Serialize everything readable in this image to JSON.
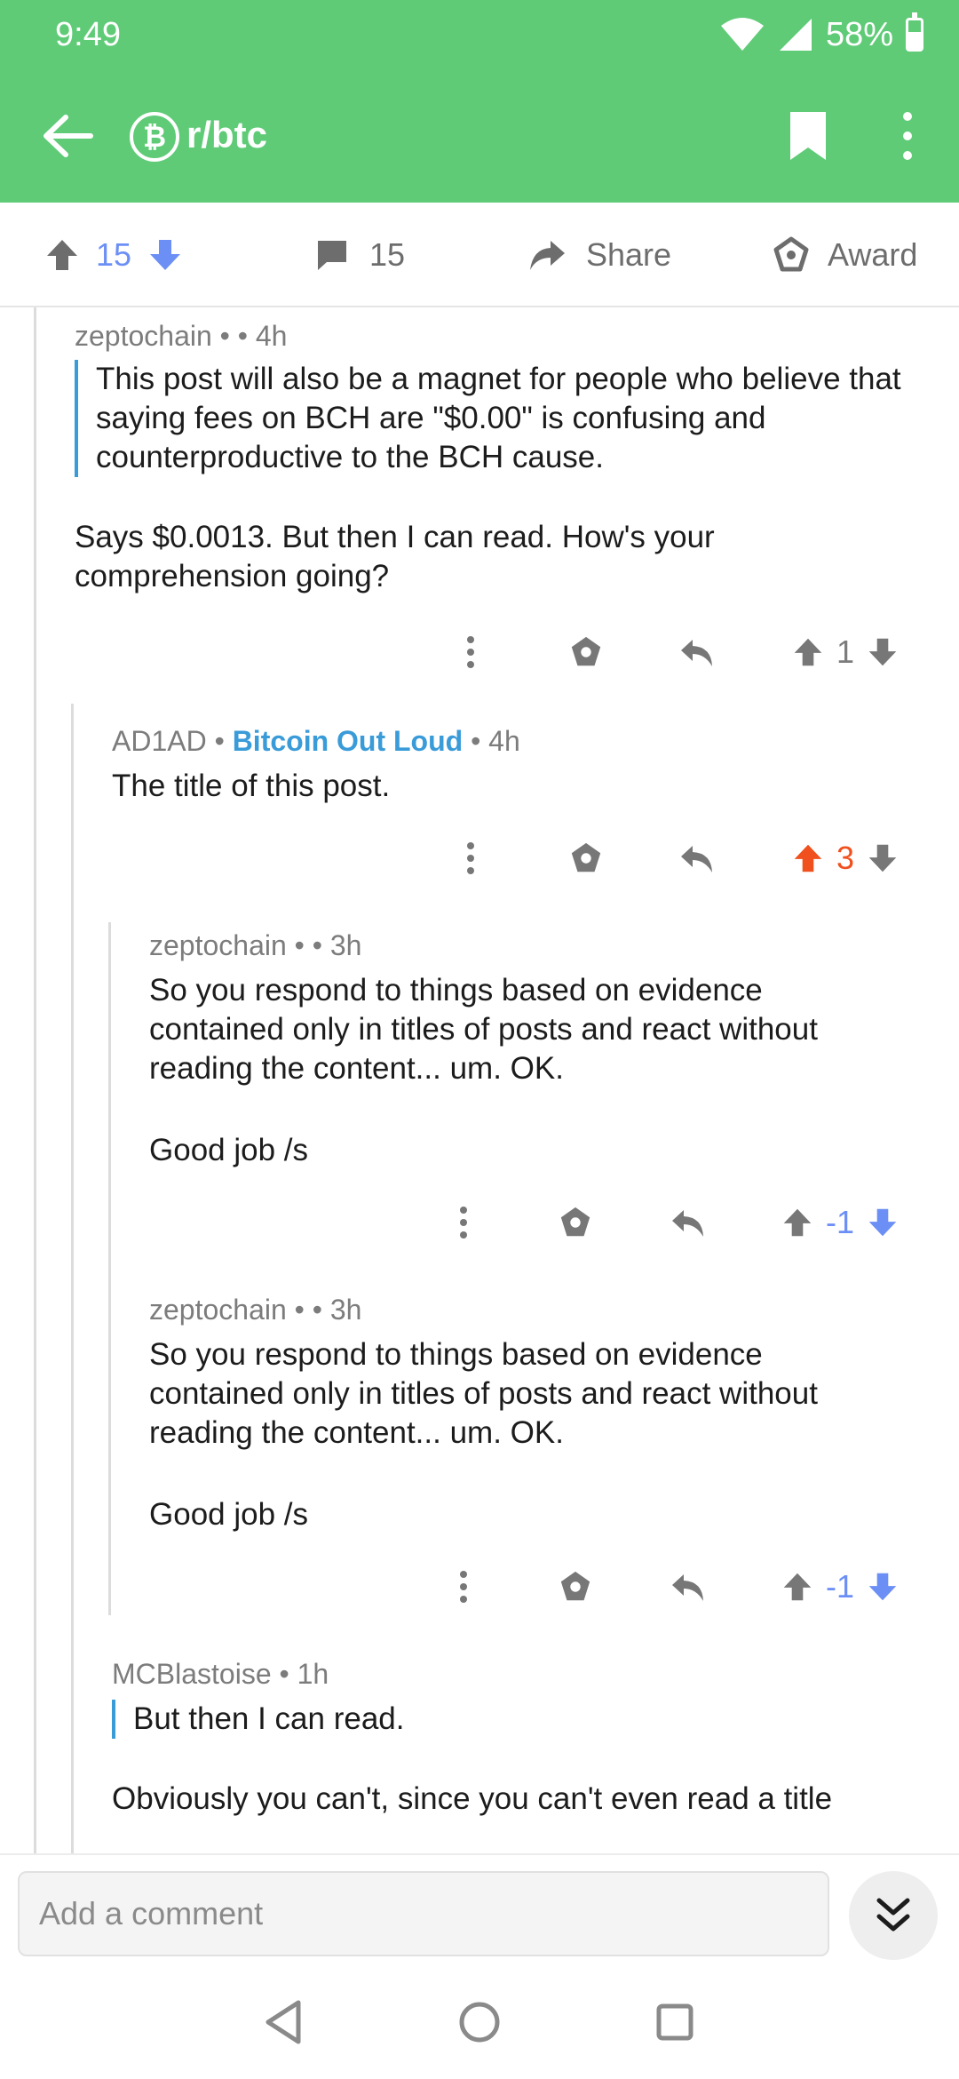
{
  "status_bar": {
    "time": "9:49",
    "battery": "58%",
    "battery_level": 0.58
  },
  "app_bar": {
    "subreddit": "r/btc",
    "subreddit_logo": "₿",
    "back_icon": "arrow-left-icon",
    "bookmark_icon": "bookmark-icon",
    "more_icon": "more-vertical-icon"
  },
  "action_bar": {
    "votes": "15",
    "comments": "15",
    "share_label": "Share",
    "award_label": "Award"
  },
  "comments": [
    {
      "author": "zeptochain",
      "flair": "",
      "time": "4h",
      "quote": "This post will also be a magnet for people who believe that saying fees on BCH are \"$0.00\" is confusing and counterproductive to the BCH cause.",
      "text": "Says $0.0013. But then I can read. How's your comprehension going?",
      "score": "1",
      "vote": "none"
    },
    {
      "author": "AD1AD",
      "flair": "Bitcoin Out Loud",
      "time": "4h",
      "text": "The title of this post.",
      "score": "3",
      "vote": "up"
    },
    {
      "author": "zeptochain",
      "flair": "",
      "time": "3h",
      "text": "So you respond to things based on evidence contained only in titles of posts and react without reading the content... um. OK.",
      "text2": "Good job /s",
      "score": "-1",
      "vote": "down"
    },
    {
      "author": "zeptochain",
      "flair": "",
      "time": "3h",
      "text": "So you respond to things based on evidence contained only in titles of posts and react without reading the content... um. OK.",
      "text2": "Good job /s",
      "score": "-1",
      "vote": "down"
    },
    {
      "author": "MCBlastoise",
      "flair": "",
      "time": "1h",
      "quote": "But then I can read.",
      "text": "Obviously you can't, since you can't even read a title"
    }
  ],
  "composer": {
    "placeholder": "Add a comment"
  },
  "colors": {
    "header": "#5fcb77",
    "upvote": "#f0501e",
    "downvote": "#6c8ff5",
    "flair": "#3a9bd9"
  }
}
